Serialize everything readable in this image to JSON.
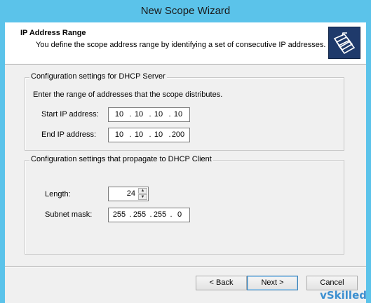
{
  "window": {
    "title": "New Scope Wizard"
  },
  "header": {
    "title": "IP Address Range",
    "description": "You define the scope address range by identifying a set of consecutive IP addresses.",
    "icon": "folder-icon"
  },
  "server_group": {
    "legend": "Configuration settings for DHCP Server",
    "instruction": "Enter the range of addresses that the scope distributes.",
    "start_label": "Start IP address:",
    "start_ip": [
      "10",
      "10",
      "10",
      "10"
    ],
    "end_label": "End IP address:",
    "end_ip": [
      "10",
      "10",
      "10",
      "200"
    ]
  },
  "client_group": {
    "legend": "Configuration settings that propagate to DHCP Client",
    "length_label": "Length:",
    "length_value": "24",
    "mask_label": "Subnet mask:",
    "mask": [
      "255",
      "255",
      "255",
      "0"
    ]
  },
  "buttons": {
    "back": "< Back",
    "next": "Next >",
    "cancel": "Cancel"
  },
  "watermark": "vSkilled"
}
